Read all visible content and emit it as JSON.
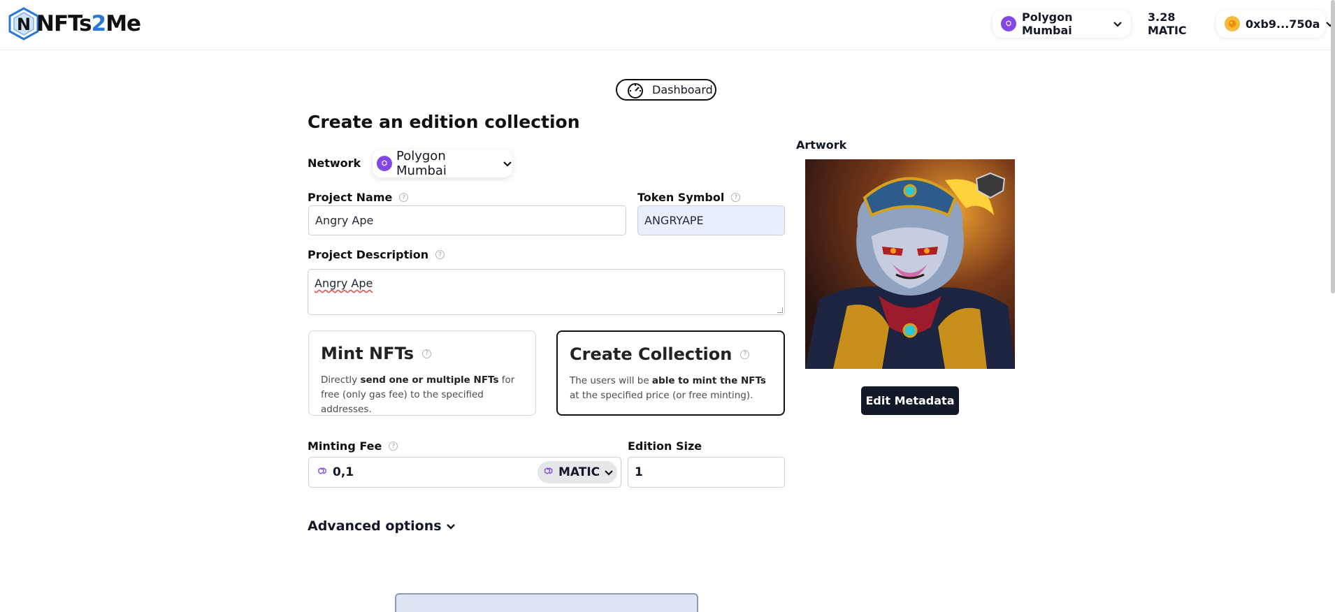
{
  "header": {
    "logo_text_a": "NFTs",
    "logo_text_b": "2",
    "logo_text_c": "Me",
    "network_label": "Polygon Mumbai",
    "balance": "3.28 MATIC",
    "account": "0xb9...750a"
  },
  "nav": {
    "dashboard_label": "Dashboard"
  },
  "page": {
    "title": "Create an edition collection"
  },
  "form": {
    "network_label": "Network",
    "network_value": "Polygon Mumbai",
    "project_name_label": "Project Name",
    "project_name_value": "Angry Ape",
    "token_symbol_label": "Token Symbol",
    "token_symbol_value": "ANGRYAPE",
    "description_label": "Project Description",
    "description_value": "Angry Ape",
    "mint_card": {
      "title": "Mint NFTs",
      "desc_a": "Directly ",
      "desc_b": "send one or multiple NFTs",
      "desc_c": " for free (only gas fee) to the specified addresses."
    },
    "create_card": {
      "title": "Create Collection",
      "desc_a": "The users will be ",
      "desc_b": "able to mint the NFTs",
      "desc_c": " at the specified price (or free minting)."
    },
    "minting_fee_label": "Minting Fee",
    "minting_fee_value": "0,1",
    "currency": "MATIC",
    "edition_size_label": "Edition Size",
    "edition_size_value": "1",
    "advanced_label": "Advanced options"
  },
  "artwork": {
    "label": "Artwork",
    "edit_button": "Edit Metadata"
  },
  "colors": {
    "polygon": "#8247e5",
    "dark_button": "#111827",
    "logo_blue": "#2a78d6"
  },
  "icons": [
    "polygon-icon",
    "chevron-down-icon",
    "dashboard-gauge-icon",
    "help-icon",
    "account-avatar-icon",
    "logo-mark-icon"
  ]
}
